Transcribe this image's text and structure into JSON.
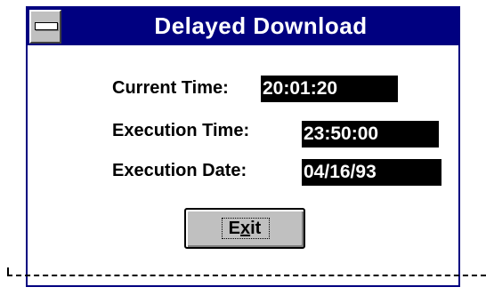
{
  "window": {
    "title": "Delayed Download",
    "title_bar_color": "#000080"
  },
  "fields": {
    "current_time_label": "Current Time:",
    "current_time_value": "20:01:20",
    "execution_time_label": "Execution Time:",
    "execution_time_value": "23:50:00",
    "execution_date_label": "Execution Date:",
    "execution_date_value": "04/16/93"
  },
  "buttons": {
    "exit_prefix": "E",
    "exit_mnemonic": "x",
    "exit_suffix": "it"
  },
  "icons": {
    "system_menu": "system-menu-icon"
  }
}
